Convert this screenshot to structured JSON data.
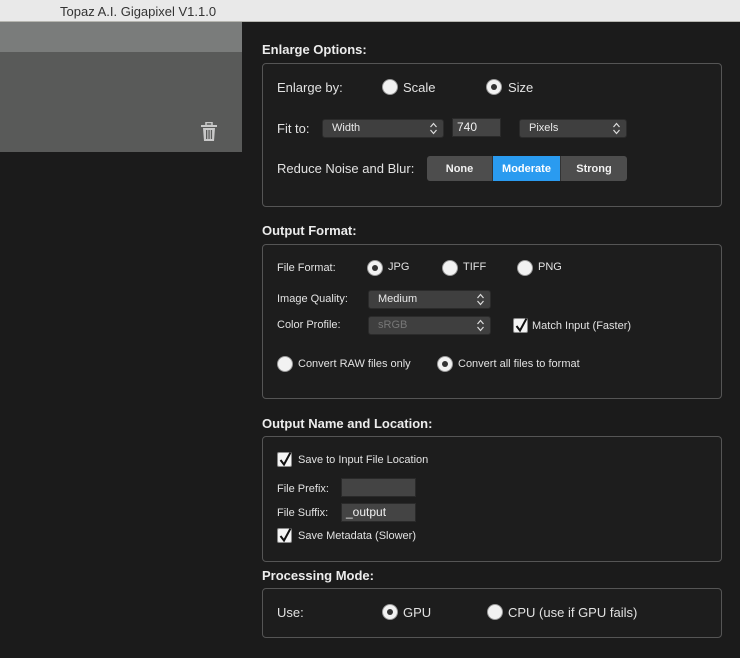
{
  "window": {
    "title": "Topaz A.I. Gigapixel V1.1.0"
  },
  "enlarge": {
    "title": "Enlarge Options:",
    "enlarge_by_label": "Enlarge by:",
    "scale_label": "Scale",
    "size_label": "Size",
    "selected_mode": "Size",
    "fit_to_label": "Fit to:",
    "fit_to_value": "Width",
    "size_value": "740",
    "unit_value": "Pixels",
    "noise_label": "Reduce Noise and Blur:",
    "noise_options": [
      "None",
      "Moderate",
      "Strong"
    ],
    "noise_selected": "Moderate"
  },
  "output_format": {
    "title": "Output Format:",
    "file_format_label": "File Format:",
    "formats": [
      "JPG",
      "TIFF",
      "PNG"
    ],
    "selected_format": "JPG",
    "quality_label": "Image Quality:",
    "quality_value": "Medium",
    "profile_label": "Color Profile:",
    "profile_value": "sRGB",
    "match_input_label": "Match Input (Faster)",
    "match_input_checked": true,
    "convert_raw_label": "Convert RAW files only",
    "convert_all_label": "Convert all files to format",
    "convert_selected": "all"
  },
  "output_name": {
    "title": "Output Name and Location:",
    "save_input_label": "Save to Input File Location",
    "save_input_checked": true,
    "prefix_label": "File Prefix:",
    "prefix_value": "",
    "suffix_label": "File Suffix:",
    "suffix_value": "_output",
    "metadata_label": "Save Metadata (Slower)",
    "metadata_checked": true
  },
  "processing": {
    "title": "Processing Mode:",
    "use_label": "Use:",
    "gpu_label": "GPU",
    "cpu_label": "CPU (use if GPU fails)",
    "selected": "GPU"
  },
  "icons": {
    "trash": "trash-icon",
    "select_arrows": "updown-arrows-icon",
    "checkmark": "checkmark-icon"
  },
  "colors": {
    "accent": "#2a9bf0",
    "background": "#1b1b1b",
    "box_border": "#555555"
  }
}
